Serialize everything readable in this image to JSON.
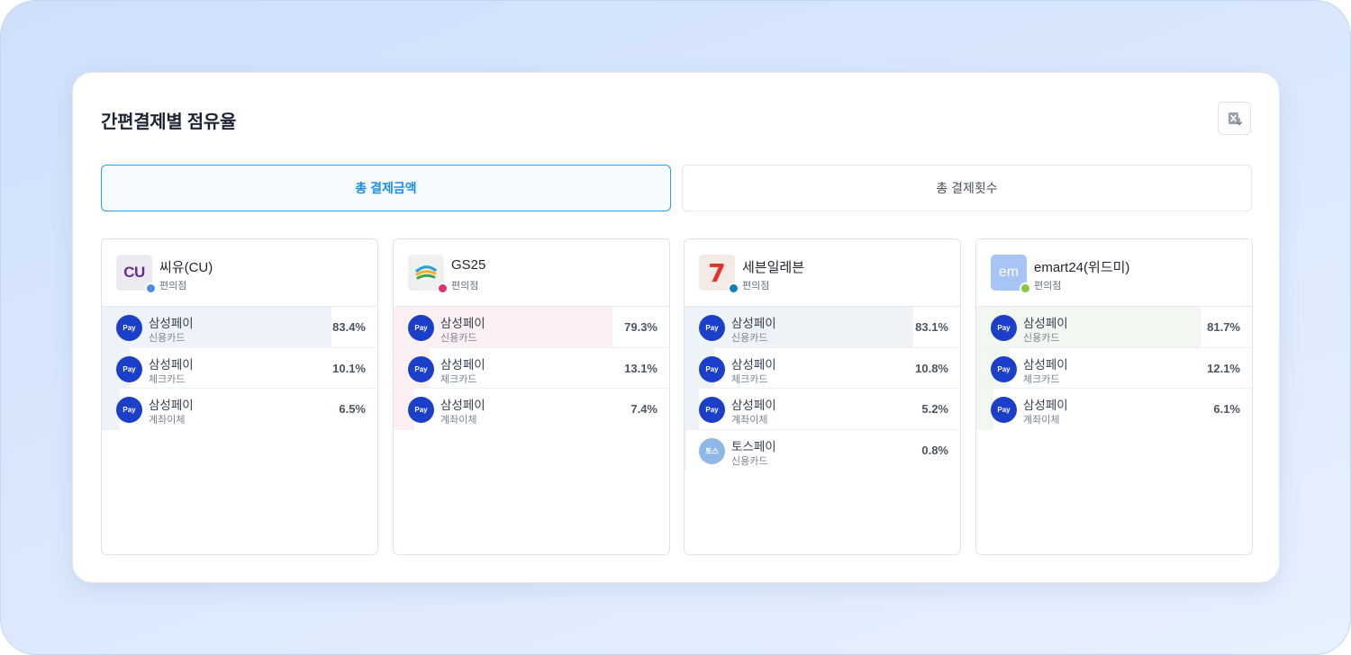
{
  "title": "간편결제별 점유율",
  "tabs": [
    {
      "label": "총 결제금액",
      "active": true
    },
    {
      "label": "총 결제횟수",
      "active": false
    }
  ],
  "stores": [
    {
      "name": "씨유(CU)",
      "type": "편의점",
      "logo_text": "CU",
      "dot_color": "#4a90e2",
      "bar_color": "#eef3fa",
      "rows": [
        {
          "pay": "삼성페이",
          "method": "신용카드",
          "percent": "83.4%",
          "share": 0.834,
          "icon": "Pay"
        },
        {
          "pay": "삼성페이",
          "method": "체크카드",
          "percent": "10.1%",
          "share": 0.101,
          "icon": "Pay"
        },
        {
          "pay": "삼성페이",
          "method": "계좌이체",
          "percent": "6.5%",
          "share": 0.065,
          "icon": "Pay"
        }
      ]
    },
    {
      "name": "GS25",
      "type": "편의점",
      "logo_text": "",
      "dot_color": "#e0336a",
      "bar_color": "#fdf0f3",
      "rows": [
        {
          "pay": "삼성페이",
          "method": "신용카드",
          "percent": "79.3%",
          "share": 0.793,
          "icon": "Pay"
        },
        {
          "pay": "삼성페이",
          "method": "체크카드",
          "percent": "13.1%",
          "share": 0.131,
          "icon": "Pay"
        },
        {
          "pay": "삼성페이",
          "method": "계좌이체",
          "percent": "7.4%",
          "share": 0.074,
          "icon": "Pay"
        }
      ]
    },
    {
      "name": "세븐일레븐",
      "type": "편의점",
      "logo_text": "7",
      "dot_color": "#137fb8",
      "bar_color": "#eef3f8",
      "rows": [
        {
          "pay": "삼성페이",
          "method": "신용카드",
          "percent": "83.1%",
          "share": 0.831,
          "icon": "Pay"
        },
        {
          "pay": "삼성페이",
          "method": "체크카드",
          "percent": "10.8%",
          "share": 0.108,
          "icon": "Pay"
        },
        {
          "pay": "삼성페이",
          "method": "계좌이체",
          "percent": "5.2%",
          "share": 0.052,
          "icon": "Pay"
        },
        {
          "pay": "토스페이",
          "method": "신용카드",
          "percent": "0.8%",
          "share": 0.008,
          "icon": "토스"
        }
      ]
    },
    {
      "name": "emart24(위드미)",
      "type": "편의점",
      "logo_text": "em",
      "dot_color": "#8cc63f",
      "bar_color": "#f3f7f1",
      "rows": [
        {
          "pay": "삼성페이",
          "method": "신용카드",
          "percent": "81.7%",
          "share": 0.817,
          "icon": "Pay"
        },
        {
          "pay": "삼성페이",
          "method": "체크카드",
          "percent": "12.1%",
          "share": 0.121,
          "icon": "Pay"
        },
        {
          "pay": "삼성페이",
          "method": "계좌이체",
          "percent": "6.1%",
          "share": 0.061,
          "icon": "Pay"
        }
      ]
    }
  ]
}
